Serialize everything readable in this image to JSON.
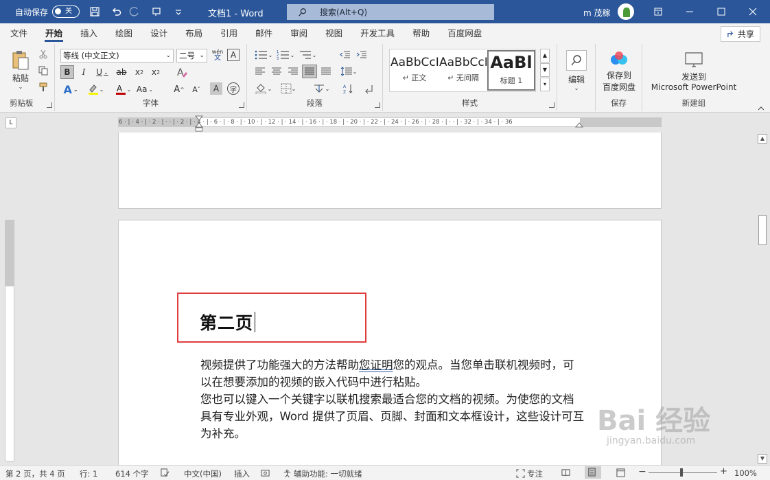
{
  "titlebar": {
    "autosave_label": "自动保存",
    "autosave_state": "关",
    "doc_title": "文档1  -  Word",
    "search_placeholder": "搜索(Alt+Q)",
    "user_name": "m 茂稼"
  },
  "tabs": [
    "文件",
    "开始",
    "插入",
    "绘图",
    "设计",
    "布局",
    "引用",
    "邮件",
    "审阅",
    "视图",
    "开发工具",
    "帮助",
    "百度网盘"
  ],
  "active_tab": "开始",
  "share_label": "共享",
  "ribbon": {
    "clipboard": {
      "paste_label": "粘贴",
      "group_label": "剪贴板"
    },
    "font": {
      "font_name": "等线 (中文正文)",
      "font_size": "二号",
      "pinyin_glyph": "wén",
      "group_label": "字体"
    },
    "paragraph": {
      "group_label": "段落"
    },
    "styles": {
      "items": [
        {
          "preview": "AaBbCcI",
          "name": "↵ 正文"
        },
        {
          "preview": "AaBbCcI",
          "name": "↵ 无间隔"
        },
        {
          "preview": "AaBl",
          "name": "标题 1"
        }
      ],
      "group_label": "样式"
    },
    "editing": {
      "label": "编辑"
    },
    "save": {
      "label_line1": "保存到",
      "label_line2": "百度网盘",
      "group_label": "保存"
    },
    "new_group": {
      "label_line1": "发送到",
      "label_line2": "Microsoft PowerPoint",
      "group_label": "新建组"
    }
  },
  "ruler": {
    "ticks": "6 · | · 4 · | · 2 · | ·   · | · 2 · | · 4 · | · 6 · | · 8 · | · 10 · | · 12 · | · 14 · | · 16 · | · 18 · | · 20 · | · 22 · | · 24 · | · 26 · | · 28 · | ·   · | · 32 · | · 34 · | · 36"
  },
  "document": {
    "heading": "第二页",
    "para1_a": "视频提供了功能强大的方法帮助",
    "para1_u": "您证明",
    "para1_b": "您的观点。当您单击联机视频时，可以在想要添加的视频的嵌入代码中进行粘贴。",
    "para2": "您也可以键入一个关键字以联机搜索最适合您的文档的视频。为使您的文档具有专业外观，Word 提供了页眉、页脚、封面和文本框设计，这些设计可互为补充。"
  },
  "statusbar": {
    "page": "第 2 页，共 4 页",
    "line": "行: 1",
    "words": "614 个字",
    "language": "中文(中国)",
    "insert_mode": "插入",
    "accessibility": "辅助功能: 一切就绪",
    "focus": "专注",
    "zoom": "100%"
  },
  "watermark": {
    "logo": "Bai 经验",
    "url": "jingyan.baidu.com"
  },
  "zoom_level": 1.0
}
